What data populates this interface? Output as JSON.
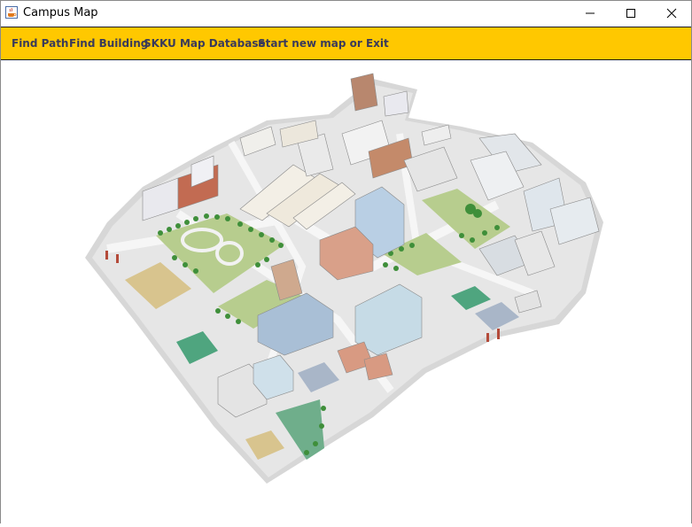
{
  "window": {
    "title": "Campus Map",
    "app_icon": "java-cup-icon",
    "controls": [
      "minimize-icon",
      "maximize-icon",
      "close-icon"
    ]
  },
  "menu": {
    "background": "#ffc800",
    "items": [
      {
        "label": "Find Path"
      },
      {
        "label": "Find Building"
      },
      {
        "label": "SKKU Map Database"
      },
      {
        "label": "Start new map or Exit"
      }
    ]
  },
  "map": {
    "description_icon": "campus-isometric-map"
  }
}
